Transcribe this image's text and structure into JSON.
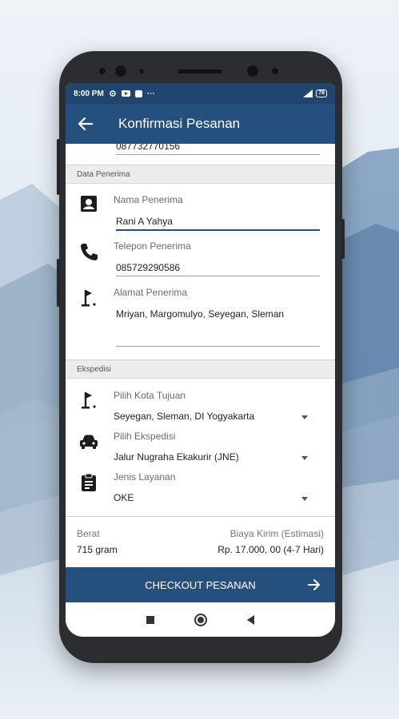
{
  "status_bar": {
    "time": "8:00 PM",
    "battery": "78"
  },
  "app_bar": {
    "title": "Konfirmasi Pesanan"
  },
  "partial_field": {
    "value": "087732770156"
  },
  "sections": {
    "recipient": "Data Penerima",
    "shipping": "Ekspedisi"
  },
  "recipient": {
    "name_label": "Nama Penerima",
    "name_value": "Rani A Yahya",
    "phone_label": "Telepon Penerima",
    "phone_value": "085729290586",
    "address_label": "Alamat Penerima",
    "address_value": "Mriyan, Margomulyo, Seyegan, Sleman"
  },
  "shipping": {
    "city_label": "Pilih Kota Tujuan",
    "city_value": "Seyegan, Sleman, DI Yogyakarta",
    "courier_label": "Pilih Ekspedisi",
    "courier_value": "Jalur Nugraha Ekakurir (JNE)",
    "service_label": "Jenis Layanan",
    "service_value": "OKE"
  },
  "summary": {
    "weight_label": "Berat",
    "weight_value": "715 gram",
    "cost_label": "Biaya Kirim (Estimasi)",
    "cost_value": "Rp. 17.000, 00 (4-7 Hari)"
  },
  "checkout": {
    "label": "CHECKOUT PESANAN"
  },
  "colors": {
    "primary": "#25507d",
    "status_bar": "#20456f"
  },
  "icons": {
    "back": "arrow-left-icon",
    "name": "contact-card-icon",
    "phone": "phone-icon",
    "address": "golf-flag-icon",
    "city": "golf-flag-icon",
    "courier": "car-icon",
    "service": "clipboard-icon",
    "checkout": "arrow-right-icon"
  }
}
